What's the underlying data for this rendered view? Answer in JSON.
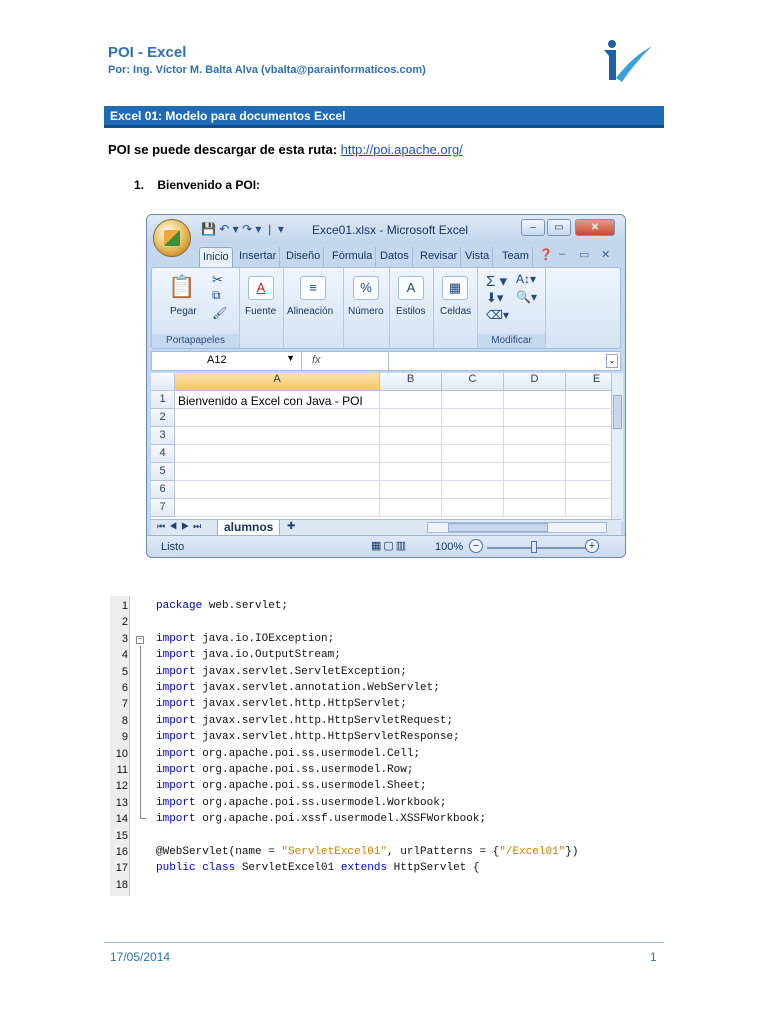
{
  "header": {
    "title": "POI - Excel",
    "author_line": "Por: Ing. Víctor M. Balta Alva (vbalta@parainformaticos.com)"
  },
  "section": {
    "title": "Excel 01: Modelo para documentos Excel"
  },
  "intro": {
    "text": "POI se puede descargar de esta ruta: ",
    "link": "http://poi.apache.org/"
  },
  "step": {
    "number": "1.",
    "label": "Bienvenido a POI:"
  },
  "excel": {
    "window_title": "Exce01.xlsx - Microsoft Excel",
    "tabs": [
      "Inicio",
      "Insertar",
      "Diseño",
      "Fórmula",
      "Datos",
      "Revisar",
      "Vista",
      "Team"
    ],
    "groups": {
      "portapapeles": "Portapapeles",
      "modificar": "Modificar",
      "pegar": "Pegar",
      "fuente": "Fuente",
      "alineacion": "Alineación",
      "numero": "Número",
      "estilos": "Estilos",
      "celdas": "Celdas",
      "numero_icon": "%"
    },
    "name_box": "A12",
    "fx": "fx",
    "columns": [
      "A",
      "B",
      "C",
      "D",
      "E"
    ],
    "rows": [
      "1",
      "2",
      "3",
      "4",
      "5",
      "6",
      "7"
    ],
    "cell_a1": "Bienvenido a Excel con Java - POI",
    "sheet_tab": "alumnos",
    "status_ready": "Listo",
    "zoom": "100%",
    "zoom_level_percent": 100
  },
  "code": {
    "lines": [
      {
        "n": "1",
        "parts": [
          {
            "t": "package",
            "k": "kw"
          },
          {
            "t": " web.servlet;",
            "k": ""
          }
        ]
      },
      {
        "n": "2",
        "parts": []
      },
      {
        "n": "3",
        "parts": [
          {
            "t": "import",
            "k": "kw"
          },
          {
            "t": " java.io.IOException;",
            "k": ""
          }
        ]
      },
      {
        "n": "4",
        "parts": [
          {
            "t": "import",
            "k": "kw"
          },
          {
            "t": " java.io.OutputStream;",
            "k": ""
          }
        ]
      },
      {
        "n": "5",
        "parts": [
          {
            "t": "import",
            "k": "kw"
          },
          {
            "t": " javax.servlet.ServletException;",
            "k": ""
          }
        ]
      },
      {
        "n": "6",
        "parts": [
          {
            "t": "import",
            "k": "kw"
          },
          {
            "t": " javax.servlet.annotation.WebServlet;",
            "k": ""
          }
        ]
      },
      {
        "n": "7",
        "parts": [
          {
            "t": "import",
            "k": "kw"
          },
          {
            "t": " javax.servlet.http.HttpServlet;",
            "k": ""
          }
        ]
      },
      {
        "n": "8",
        "parts": [
          {
            "t": "import",
            "k": "kw"
          },
          {
            "t": " javax.servlet.http.HttpServletRequest;",
            "k": ""
          }
        ]
      },
      {
        "n": "9",
        "parts": [
          {
            "t": "import",
            "k": "kw"
          },
          {
            "t": " javax.servlet.http.HttpServletResponse;",
            "k": ""
          }
        ]
      },
      {
        "n": "10",
        "parts": [
          {
            "t": "import",
            "k": "kw"
          },
          {
            "t": " org.apache.poi.ss.usermodel.Cell;",
            "k": ""
          }
        ]
      },
      {
        "n": "11",
        "parts": [
          {
            "t": "import",
            "k": "kw"
          },
          {
            "t": " org.apache.poi.ss.usermodel.Row;",
            "k": ""
          }
        ]
      },
      {
        "n": "12",
        "parts": [
          {
            "t": "import",
            "k": "kw"
          },
          {
            "t": " org.apache.poi.ss.usermodel.Sheet;",
            "k": ""
          }
        ]
      },
      {
        "n": "13",
        "parts": [
          {
            "t": "import",
            "k": "kw"
          },
          {
            "t": " org.apache.poi.ss.usermodel.Workbook;",
            "k": ""
          }
        ]
      },
      {
        "n": "14",
        "parts": [
          {
            "t": "import",
            "k": "kw"
          },
          {
            "t": " org.apache.poi.xssf.usermodel.XSSFWorkbook;",
            "k": ""
          }
        ]
      },
      {
        "n": "15",
        "parts": []
      },
      {
        "n": "16",
        "parts": [
          {
            "t": "@WebServlet(name = ",
            "k": ""
          },
          {
            "t": "\"ServletExcel01\"",
            "k": "str"
          },
          {
            "t": ", urlPatterns = {",
            "k": ""
          },
          {
            "t": "\"/Excel01\"",
            "k": "str"
          },
          {
            "t": "})",
            "k": ""
          }
        ]
      },
      {
        "n": "17",
        "parts": [
          {
            "t": "public class",
            "k": "kw"
          },
          {
            "t": " ServletExcel01 ",
            "k": ""
          },
          {
            "t": "extends",
            "k": "kw"
          },
          {
            "t": " HttpServlet {",
            "k": ""
          }
        ]
      },
      {
        "n": "18",
        "parts": []
      }
    ]
  },
  "footer": {
    "date": "17/05/2014",
    "page": "1"
  }
}
